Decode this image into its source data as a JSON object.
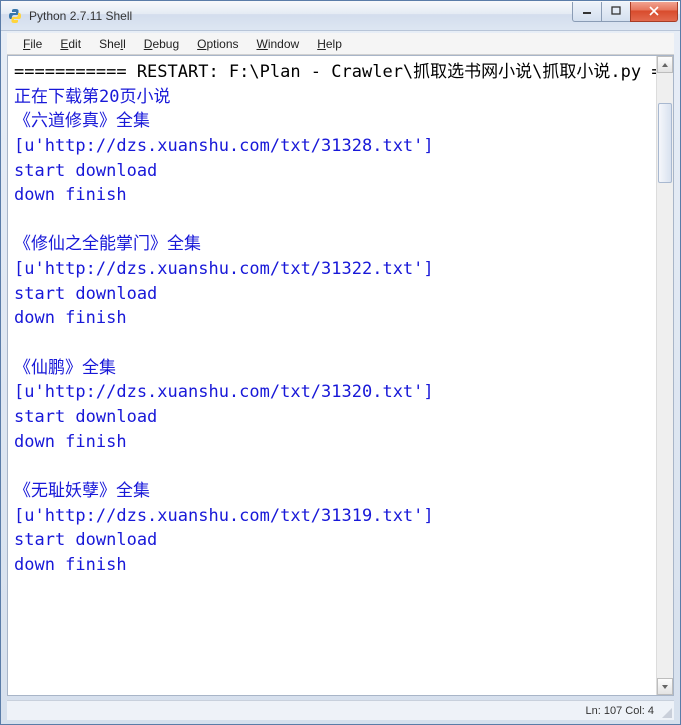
{
  "window": {
    "title": "Python 2.7.11 Shell"
  },
  "menu": {
    "file": "File",
    "edit": "Edit",
    "shell": "Shell",
    "debug": "Debug",
    "options": "Options",
    "window": "Window",
    "help": "Help"
  },
  "output": {
    "restart_line": "=========== RESTART: F:\\Plan - Crawler\\抓取选书网小说\\抓取小说.py ===========",
    "l01": "正在下载第20页小说",
    "l02": "《六道修真》全集",
    "l03": "[u'http://dzs.xuanshu.com/txt/31328.txt']",
    "l04": "start download",
    "l05": "down finish",
    "l06": "",
    "l07": "《修仙之全能掌门》全集",
    "l08": "[u'http://dzs.xuanshu.com/txt/31322.txt']",
    "l09": "start download",
    "l10": "down finish",
    "l11": "",
    "l12": "《仙鹏》全集",
    "l13": "[u'http://dzs.xuanshu.com/txt/31320.txt']",
    "l14": "start download",
    "l15": "down finish",
    "l16": "",
    "l17": "《无耻妖孽》全集",
    "l18": "[u'http://dzs.xuanshu.com/txt/31319.txt']",
    "l19": "start download",
    "l20": "down finish"
  },
  "status": {
    "pos": "Ln: 107  Col: 4"
  }
}
